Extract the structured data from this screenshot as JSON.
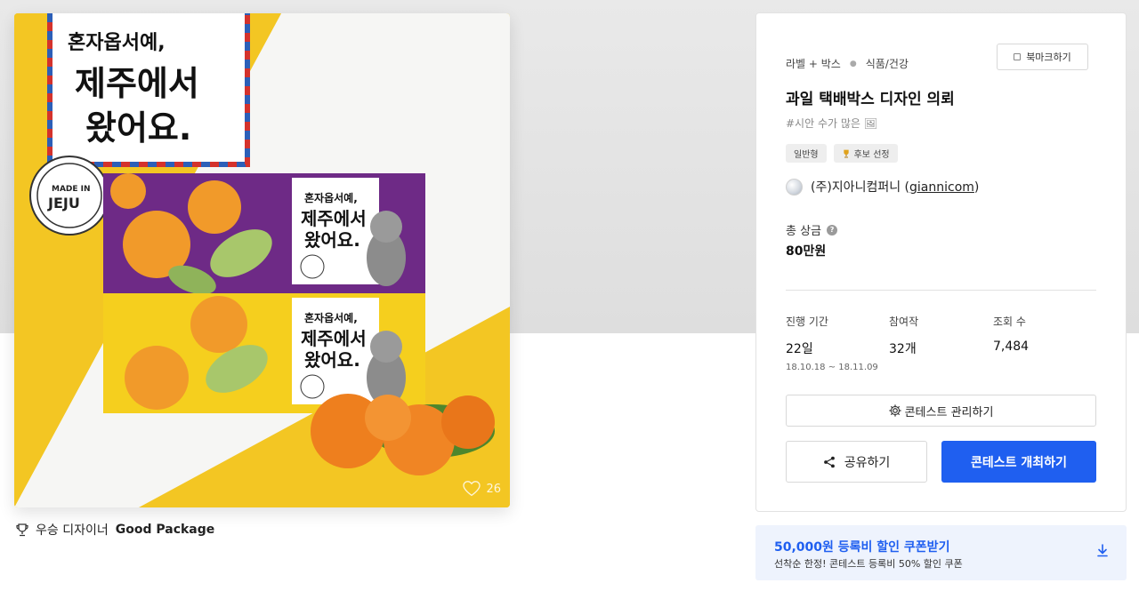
{
  "hero": {
    "alt_lines": [
      "혼자옵서예,",
      "제주에서",
      "왔어요."
    ],
    "stamp_text": "MADE IN JEJU",
    "like_count": "26"
  },
  "winner": {
    "prefix": "우승 디자이너",
    "name": "Good Package"
  },
  "info": {
    "category_type": "라벨 + 박스",
    "category_field": "식품/건강",
    "bookmark_label": "북마크하기",
    "title": "과일 택배박스 디자인 의뢰",
    "tagline": "#시안 수가 많은 🖼",
    "badges": [
      "일반형",
      "후보 선정"
    ],
    "company_name": "(주)지아니컴퍼니",
    "company_id": "giannicom",
    "prize_label": "총 상금",
    "prize_value": "80만원",
    "stats": {
      "period_label": "진행 기간",
      "period_value": "22일",
      "period_range": "18.10.18 ~ 18.11.09",
      "entries_label": "참여작",
      "entries_value": "32개",
      "views_label": "조회 수",
      "views_value": "7,484"
    },
    "manage_label": "콘테스트 관리하기",
    "share_label": "공유하기",
    "host_label": "콘테스트 개최하기"
  },
  "coupon": {
    "title": "50,000원 등록비 할인 쿠폰받기",
    "subtitle": "선착순 한정! 콘테스트 등록비 50% 할인 쿠폰"
  },
  "colors": {
    "accent": "#1f5ff0",
    "purple_box": "#6e2a86",
    "yellow_box": "#f5cf1e"
  }
}
